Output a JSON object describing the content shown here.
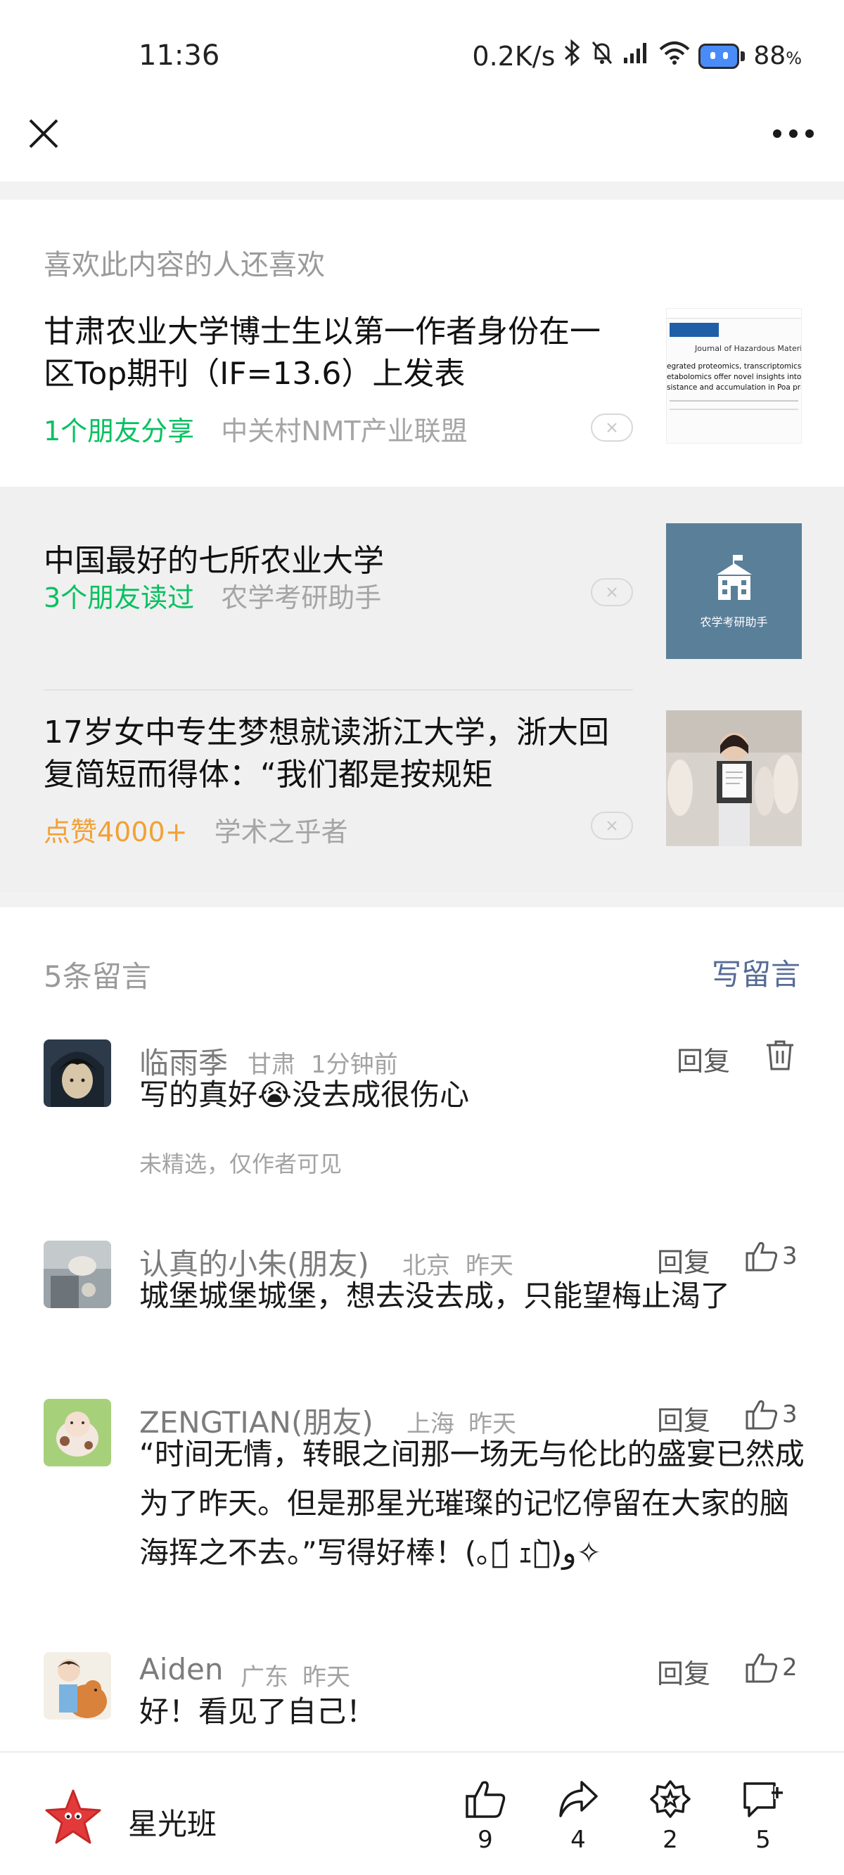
{
  "status_bar": {
    "time": "11:36",
    "net_speed": "0.2K/s",
    "battery": "88",
    "battery_unit": "%",
    "icons": [
      "bluetooth-icon",
      "mute-icon",
      "signal-icon",
      "wifi-icon",
      "battery-icon"
    ]
  },
  "nav": {
    "close_icon": "close-icon",
    "more_icon": "more-icon"
  },
  "recommend": {
    "heading": "喜欢此内容的人还喜欢",
    "items": [
      {
        "title": "甘肃农业大学博士生以第一作者身份在一区Top期刊（IF=13.6）上发表",
        "meta": "1个朋友分享",
        "meta_kind": "friend",
        "source": "中关村NMT产业联盟",
        "thumb_title": "Journal of Hazardous Materials",
        "thumb_text1": "egrated proteomics, transcriptomics, and",
        "thumb_text2": "etabolomics offer novel insights into Cd",
        "thumb_text3": "sistance and accumulation in Poa pratensi"
      },
      {
        "title": "中国最好的七所农业大学",
        "meta": "3个朋友读过",
        "meta_kind": "friend",
        "source": "农学考研助手",
        "thumb_caption": "农学考研助手"
      },
      {
        "title": "17岁女中专生梦想就读浙江大学，浙大回复简短而得体：“我们都是按规矩",
        "meta": "点赞4000+",
        "meta_kind": "likes",
        "source": "学术之乎者"
      }
    ]
  },
  "comments": {
    "header": "5条留言",
    "write_label": "写留言",
    "reply_label": "回复",
    "items": [
      {
        "name": "临雨季",
        "location": "甘肃",
        "time": "1分钟前",
        "text": "写的真好😭没去成很伤心",
        "note": "未精选，仅作者可见",
        "likes": ""
      },
      {
        "name": "认真的小朱(朋友)",
        "location": "北京",
        "time": "昨天",
        "text": "城堡城堡城堡，想去没去成，只能望梅止渴了",
        "likes": "3"
      },
      {
        "name": "ZENGTIAN(朋友)",
        "location": "上海",
        "time": "昨天",
        "text": "“时间无情，转眼之间那一场无与伦比的盛宴已然成为了昨天。但是那星光璀璨的记忆停留在大家的脑海挥之不去。”写得好棒！(｡･᷄ ｪ･᷅)و✧",
        "likes": "3"
      },
      {
        "name": "Aiden",
        "location": "广东",
        "time": "昨天",
        "text": "好！看见了自己！",
        "likes": "2"
      }
    ]
  },
  "bottom_bar": {
    "account_name": "星光班",
    "like_count": "9",
    "share_count": "4",
    "wow_count": "2",
    "comment_count": "5"
  },
  "colors": {
    "friend_green": "#07c160",
    "likes_orange": "#f3a034",
    "link_blue": "#576b95"
  }
}
